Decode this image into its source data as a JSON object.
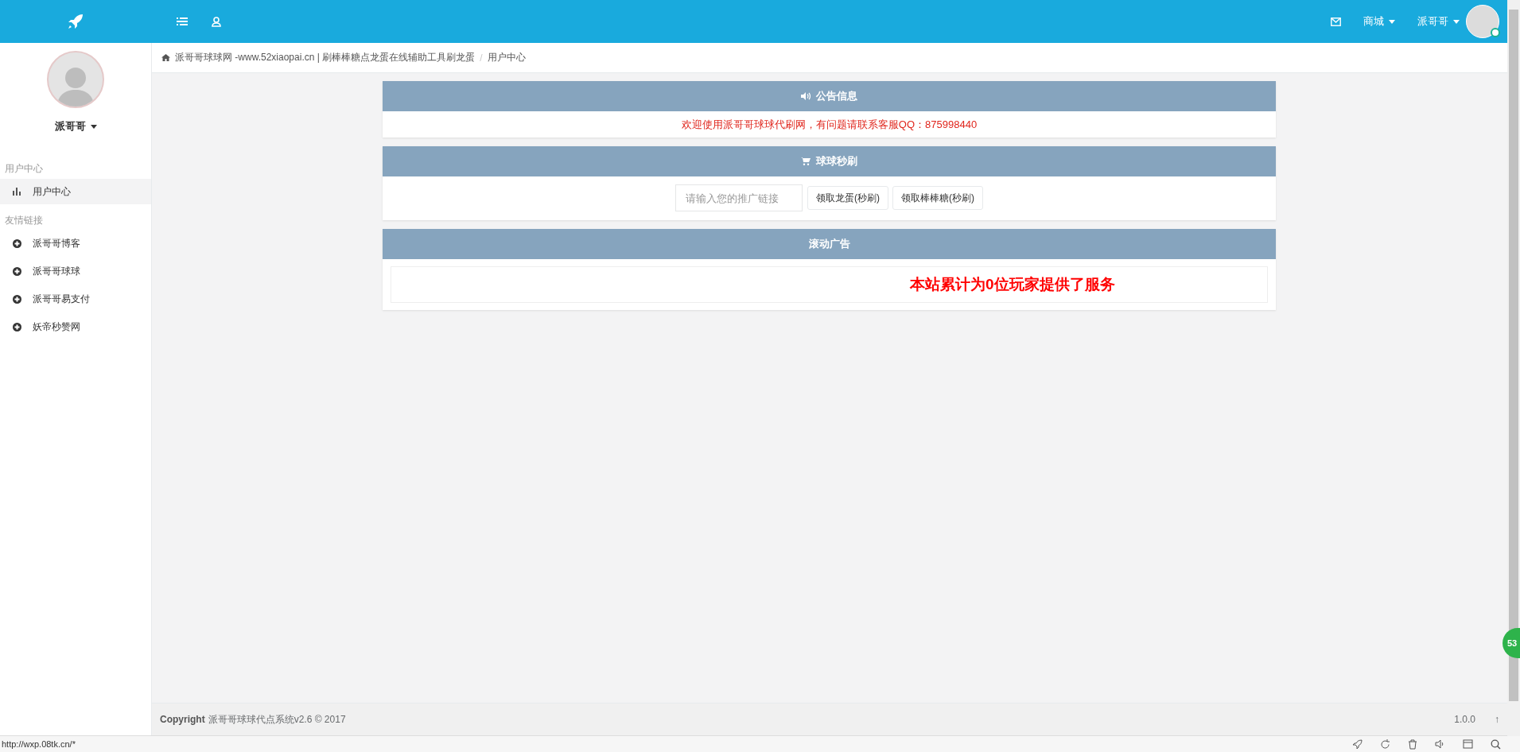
{
  "topbar": {
    "menus": [
      {
        "label": "商城"
      },
      {
        "label": "派哥哥"
      }
    ]
  },
  "sidebar": {
    "user_name": "派哥哥",
    "sections": [
      {
        "title": "用户中心",
        "items": [
          {
            "label": "用户中心",
            "kind": "chart",
            "selected": true
          }
        ]
      },
      {
        "title": "友情链接",
        "items": [
          {
            "label": "派哥哥博客",
            "kind": "link",
            "selected": false
          },
          {
            "label": "派哥哥球球",
            "kind": "link",
            "selected": false
          },
          {
            "label": "派哥哥易支付",
            "kind": "link",
            "selected": false
          },
          {
            "label": "妖帝秒赞网",
            "kind": "link",
            "selected": false
          }
        ]
      }
    ]
  },
  "breadcrumb": {
    "items": [
      "派哥哥球球网 -www.52xiaopai.cn | 刷棒棒糖点龙蛋在线辅助工具刷龙蛋",
      "用户中心"
    ],
    "separator": "/"
  },
  "panels": [
    {
      "kind": "notice",
      "title": "公告信息",
      "text": "欢迎使用派哥哥球球代刷网，有问题请联系客服QQ：875998440"
    },
    {
      "kind": "form",
      "title": "球球秒刷",
      "placeholder": "请输入您的推广链接",
      "buttons": [
        "领取龙蛋(秒刷)",
        "领取棒棒糖(秒刷)"
      ]
    },
    {
      "kind": "marquee",
      "title": "滚动广告",
      "text": "本站累计为0位玩家提供了服务"
    }
  ],
  "footer": {
    "label": "Copyright",
    "text": "派哥哥球球代点系统v2.6 © 2017",
    "version": "1.0.0",
    "top_arrow": "↑"
  },
  "floating_badge": "53",
  "status_bar": {
    "url": "http://wxp.08tk.cn/*"
  }
}
